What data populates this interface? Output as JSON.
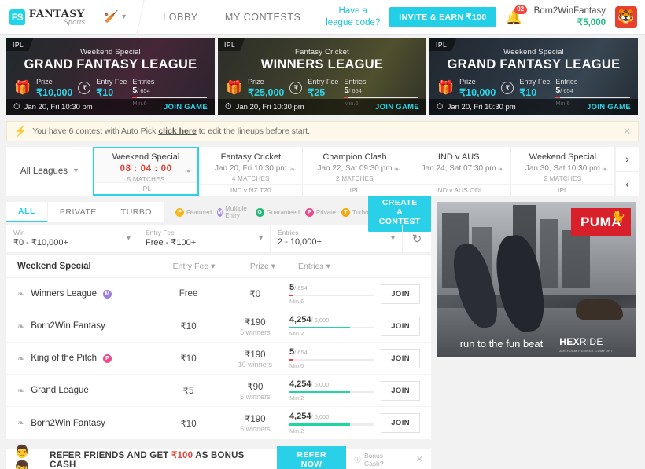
{
  "header": {
    "logo_mark": "FS",
    "logo_main": "FANTASY",
    "logo_sub": "Sports",
    "sport_icon": "cricket-bat-icon",
    "nav": [
      {
        "label": "LOBBY"
      },
      {
        "label": "MY CONTESTS"
      }
    ],
    "league_code_line1": "Have a",
    "league_code_line2": "league code?",
    "invite_label": "INVITE & EARN ₹100",
    "notification_count": "02",
    "user_name": "Born2WinFantasy",
    "user_balance": "₹5,000",
    "avatar_icon": "tiger-mascot-icon"
  },
  "banners": [
    {
      "tag": "IPL",
      "subtitle": "Weekend Special",
      "title": "GRAND FANTASY LEAGUE",
      "prize_label": "Prize",
      "prize_value": "₹10,000",
      "fee_label": "Entry Fee",
      "fee_value": "₹10",
      "entries_label": "Entries",
      "entries_filled": "5",
      "entries_total": "/ 654",
      "entries_min": "Min.6",
      "entries_pct": 6,
      "date": "Jan 20, Fri 10:30 pm",
      "cta": "JOIN GAME"
    },
    {
      "tag": "IPL",
      "subtitle": "Fantasy Cricket",
      "title": "WINNERS LEAGUE",
      "prize_label": "Prize",
      "prize_value": "₹25,000",
      "fee_label": "Entry Fee",
      "fee_value": "₹25",
      "entries_label": "Entries",
      "entries_filled": "5",
      "entries_total": "/ 654",
      "entries_min": "Min.6",
      "entries_pct": 6,
      "date": "Jan 20, Fri 10:30 pm",
      "cta": "JOIN GAME"
    },
    {
      "tag": "IPL",
      "subtitle": "Weekend Special",
      "title": "GRAND FANTASY LEAGUE",
      "prize_label": "Prize",
      "prize_value": "₹10,000",
      "fee_label": "Entry Fee",
      "fee_value": "₹10",
      "entries_label": "Entries",
      "entries_filled": "5",
      "entries_total": "/ 654",
      "entries_min": "Min.6",
      "entries_pct": 6,
      "date": "Jan 20, Fri 10:30 pm",
      "cta": "JOIN GAME"
    }
  ],
  "autopick": {
    "icon": "lightning-bolt-icon",
    "text_before": "You have 6 contest with Auto Pick ",
    "link": "click here",
    "text_after": " to edit the lineups before start.",
    "close": "✕"
  },
  "matchbar": {
    "all_leagues_label": "All Leagues",
    "tabs": [
      {
        "name": "Weekend Special",
        "time": "08 : 04 : 00",
        "is_countdown": true,
        "matches": "5 MATCHES",
        "league": "IPL",
        "active": true
      },
      {
        "name": "Fantasy Cricket",
        "time": "Jan 20, Fri 10:30 pm",
        "is_countdown": false,
        "matches": "4 MATCHES",
        "league": "IND v NZ T20",
        "active": false
      },
      {
        "name": "Champion Clash",
        "time": "Jan 22, Sat 09:30 pm",
        "is_countdown": false,
        "matches": "2 MATCHES",
        "league": "IPL",
        "active": false
      },
      {
        "name": "IND v AUS",
        "time": "Jan 24, Sat 07:30 pm",
        "is_countdown": false,
        "matches": "",
        "league": "IND v AUS ODI",
        "active": false
      },
      {
        "name": "Weekend Special",
        "time": "Jan 30, Sat 10:30 pm",
        "is_countdown": false,
        "matches": "2 MATCHES",
        "league": "IPL",
        "active": false
      }
    ],
    "next_arrow": "›",
    "prev_arrow": "‹"
  },
  "filters": {
    "tabs": [
      {
        "label": "ALL",
        "active": true
      },
      {
        "label": "PRIVATE",
        "active": false
      },
      {
        "label": "TURBO",
        "active": false
      }
    ],
    "legend": [
      {
        "letter": "F",
        "label": "Featured",
        "color": "#f5b61d"
      },
      {
        "letter": "M",
        "label": "Multiple Entry",
        "color": "#a08ce0"
      },
      {
        "letter": "G",
        "label": "Guaranteed",
        "color": "#22b573"
      },
      {
        "letter": "P",
        "label": "Private",
        "color": "#ee4b8b"
      },
      {
        "letter": "T",
        "label": "Turbo",
        "color": "#f0a90f"
      }
    ],
    "create_label": "CREATE A CONTEST",
    "dropdowns": [
      {
        "label": "Win",
        "value": "₹0 - ₹10,000+"
      },
      {
        "label": "Entry Fee",
        "value": "Free - ₹100+"
      },
      {
        "label": "Entries",
        "value": "2 - 10,000+"
      }
    ],
    "reset_icon": "reset-icon"
  },
  "contests": {
    "group_title": "Weekend Special",
    "columns": [
      {
        "label": "Entry Fee"
      },
      {
        "label": "Prize"
      },
      {
        "label": "Entries"
      }
    ],
    "rows": [
      {
        "name": "Winners League",
        "badge": {
          "letter": "M",
          "color": "#9b7ee0"
        },
        "fee": "Free",
        "prize": "₹0",
        "winners": "",
        "entries_filled": "5",
        "entries_total": "/ 654",
        "entries_min": "Min.6",
        "entries_pct": 5,
        "bar_color": "#ef3f34",
        "join_label": "JOIN"
      },
      {
        "name": "Born2Win Fantasy",
        "badge": null,
        "fee": "₹10",
        "prize": "₹190",
        "winners": "5 winners",
        "entries_filled": "4,254",
        "entries_total": "/ 6,000",
        "entries_min": "Min.2",
        "entries_pct": 71,
        "bar_color": "#1fd6a0",
        "join_label": "JOIN"
      },
      {
        "name": "King of the Pitch",
        "badge": {
          "letter": "P",
          "color": "#ee4b8b"
        },
        "fee": "₹10",
        "prize": "₹190",
        "winners": "10 winners",
        "entries_filled": "5",
        "entries_total": "/ 654",
        "entries_min": "Min.6",
        "entries_pct": 5,
        "bar_color": "#ef3f34",
        "join_label": "JOIN"
      },
      {
        "name": "Grand League",
        "badge": null,
        "fee": "₹5",
        "prize": "₹90",
        "winners": "5 winners",
        "entries_filled": "4,254",
        "entries_total": "/ 6,000",
        "entries_min": "Min.2",
        "entries_pct": 71,
        "bar_color": "#1fd6a0",
        "join_label": "JOIN"
      },
      {
        "name": "Born2Win Fantasy",
        "badge": null,
        "fee": "₹10",
        "prize": "₹190",
        "winners": "5 winners",
        "entries_filled": "4,254",
        "entries_total": "/ 6,000",
        "entries_min": "Min.2",
        "entries_pct": 71,
        "bar_color": "#1fd6a0",
        "join_label": "JOIN"
      }
    ]
  },
  "ad": {
    "brand": "PUMA",
    "tagline": "run to the fun beat",
    "product_bold": "HEX",
    "product_light": "RIDE",
    "product_sub": "AIR FOAM RUNNER COMFORT"
  },
  "refer": {
    "faces_icon": "two-avatars-icon",
    "text_a": "REFER FRIENDS AND GET ",
    "amount": "₹100",
    "text_b": " AS BONUS CASH",
    "button": "REFER NOW",
    "bonus_q": "Bonus Cash?",
    "close": "✕"
  }
}
